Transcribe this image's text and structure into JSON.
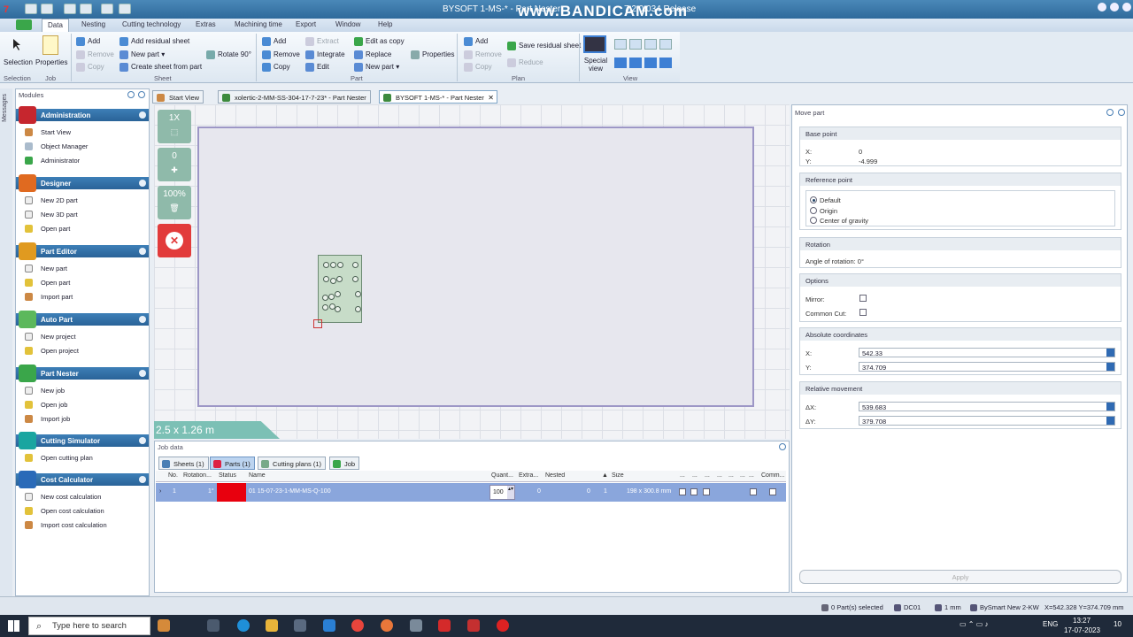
{
  "window": {
    "title": "BYSOFT 1-MS-* - Part Nester",
    "version": "7.2.0.034 Release",
    "watermark": "www.BANDICAM.com"
  },
  "menu": {
    "tabs": [
      "Data",
      "Nesting",
      "Cutting technology",
      "Extras",
      "Machining time",
      "Export",
      "Window",
      "Help"
    ]
  },
  "ribbon": {
    "selection": "Selection",
    "properties": "Properties",
    "sheet": {
      "add": "Add",
      "remove": "Remove",
      "copy": "Copy",
      "add_residual": "Add residual sheet",
      "new_part": "New part",
      "create_from_part": "Create sheet from part",
      "rotate": "Rotate 90°"
    },
    "part": {
      "add": "Add",
      "remove": "Remove",
      "copy": "Copy",
      "extract": "Extract",
      "integrate": "Integrate",
      "edit": "Edit",
      "edit_copy": "Edit as copy",
      "replace": "Replace",
      "new_part": "New part",
      "properties": "Properties"
    },
    "plan": {
      "add": "Add",
      "remove": "Remove",
      "copy": "Copy",
      "save_residual": "Save residual sheet",
      "reduce": "Reduce"
    },
    "special_view": "Special view",
    "groups": {
      "selection": "Selection",
      "job": "Job",
      "sheet": "Sheet",
      "part": "Part",
      "plan": "Plan",
      "view": "View"
    }
  },
  "sidebar": {
    "header": "Modules",
    "messages": "Messages",
    "sections": [
      {
        "title": "Administration",
        "items": [
          "Start View",
          "Object Manager",
          "Administrator"
        ]
      },
      {
        "title": "Designer",
        "items": [
          "New 2D part",
          "New 3D part",
          "Open part"
        ]
      },
      {
        "title": "Part Editor",
        "items": [
          "New part",
          "Open part",
          "Import part"
        ]
      },
      {
        "title": "Auto Part",
        "items": [
          "New project",
          "Open project"
        ]
      },
      {
        "title": "Part Nester",
        "items": [
          "New job",
          "Open job",
          "Import job"
        ]
      },
      {
        "title": "Cutting Simulator",
        "items": [
          "Open cutting plan"
        ]
      },
      {
        "title": "Cost Calculator",
        "items": [
          "New cost calculation",
          "Open cost calculation",
          "Import cost calculation"
        ]
      }
    ]
  },
  "doc_tabs": [
    "Start View",
    "xolertic-2-MM-SS-304-17-7-23* - Part Nester",
    "BYSOFT 1-MS-* - Part Nester"
  ],
  "canvas": {
    "tools": [
      {
        "value": "1X"
      },
      {
        "value": "0"
      },
      {
        "value": "100%"
      }
    ],
    "dimension": "2.5 x 1.26 m"
  },
  "job_data": {
    "header": "Job data",
    "tabs": [
      "Sheets (1)",
      "Parts (1)",
      "Cutting plans (1)",
      "Job"
    ],
    "columns": [
      "No.",
      "Rotation...",
      "Status",
      "Name",
      "Quant...",
      "Extra...",
      "Nested",
      "",
      "Size",
      "...",
      "...",
      "...",
      "...",
      "...",
      "...",
      "...",
      "Comm..."
    ],
    "row": {
      "no": "1",
      "rotation": "1°",
      "name": "01 15-07-23-1-MM-MS-Q-100",
      "quantity": "100",
      "extra": "0",
      "nested": "0",
      "priority": "1",
      "size": "198 x 300.8 mm",
      "status_color": "#e8000e"
    }
  },
  "move_part": {
    "title": "Move part",
    "base_point": {
      "label": "Base point",
      "x_label": "X:",
      "x": "0",
      "y_label": "Y:",
      "y": "-4.999"
    },
    "reference_point": {
      "label": "Reference point",
      "options": [
        "Default",
        "Origin",
        "Center of gravity"
      ],
      "selected": 0
    },
    "rotation": {
      "label": "Rotation",
      "text": "Angle of rotation: 0°"
    },
    "options": {
      "label": "Options",
      "mirror": "Mirror:",
      "common_cut": "Common Cut:"
    },
    "absolute": {
      "label": "Absolute coordinates",
      "x_label": "X:",
      "x": "542.33",
      "y_label": "Y:",
      "y": "374.709"
    },
    "relative": {
      "label": "Relative movement",
      "dx_label": "ΔX:",
      "dx": "539.683",
      "dy_label": "ΔY:",
      "dy": "379.708"
    },
    "apply": "Apply"
  },
  "statusbar": {
    "selected": "0 Part(s) selected",
    "layer": "DC01",
    "unit": "1 mm",
    "machine": "BySmart New 2-KW",
    "coords": "X=542.328 Y=374.709 mm"
  },
  "taskbar": {
    "search_placeholder": "Type here to search",
    "lang": "ENG",
    "time": "13:27",
    "date": "17-07-2023",
    "notifications": "10"
  },
  "colors": {
    "ribbon_blue": "#2f6a9b",
    "sheet_border": "#9d97c6",
    "part_fill": "#c7dcc8",
    "status_red": "#e8000e",
    "selected_row": "#8aa6dc",
    "tool_green": "#8fbaaa"
  }
}
